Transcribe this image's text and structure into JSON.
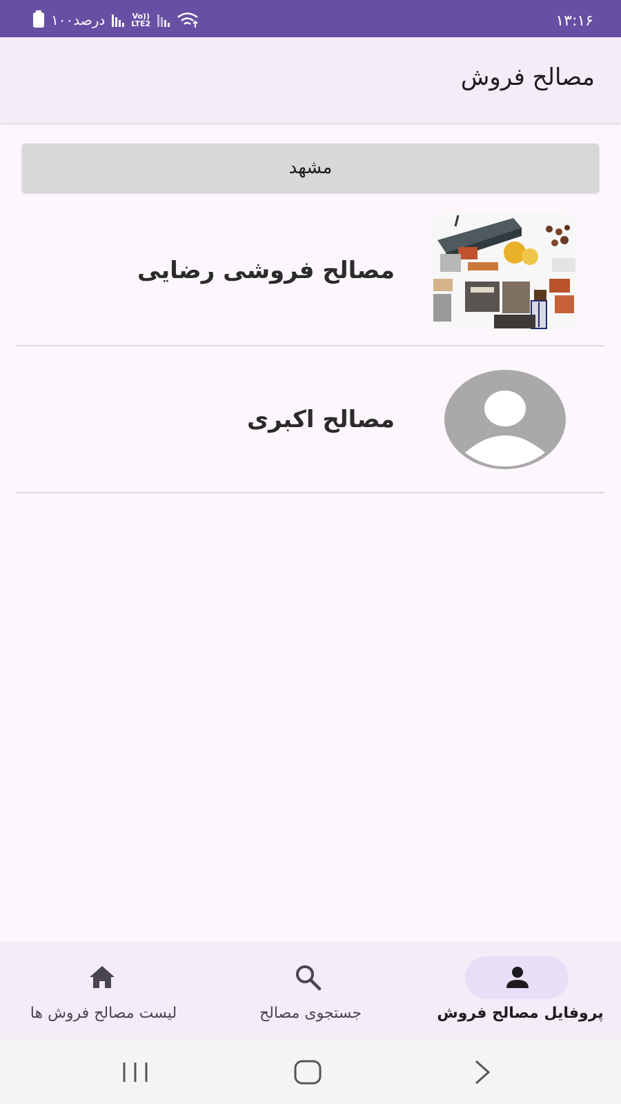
{
  "status_bar": {
    "time": "۱۳:۱۶",
    "battery_text": "۱۰۰درصد",
    "network_label_top": "Vo))",
    "network_label_bottom": "LTE2",
    "background_color": "#6750a4"
  },
  "app_bar": {
    "title": "مصالح فروش"
  },
  "city_button": {
    "label": "مشهد"
  },
  "sellers": [
    {
      "name": "مصالح فروشی رضایی",
      "image": "building-materials-photo"
    },
    {
      "name": "مصالح اکبری",
      "image": "default-avatar-icon"
    }
  ],
  "bottom_nav": {
    "items": [
      {
        "label": "پروفایل مصالح فروش",
        "icon": "person-icon",
        "active": true
      },
      {
        "label": "جستجوی مصالح",
        "icon": "search-icon",
        "active": false
      },
      {
        "label": "لیست مصالح فروش ها",
        "icon": "home-icon",
        "active": false
      }
    ]
  },
  "system_nav": {
    "buttons": [
      "recent-apps",
      "home",
      "back"
    ]
  },
  "colors": {
    "accent": "#6750a4",
    "active_pill": "#e8def8",
    "surface": "#f3edf7",
    "background": "#fdf7fd"
  }
}
